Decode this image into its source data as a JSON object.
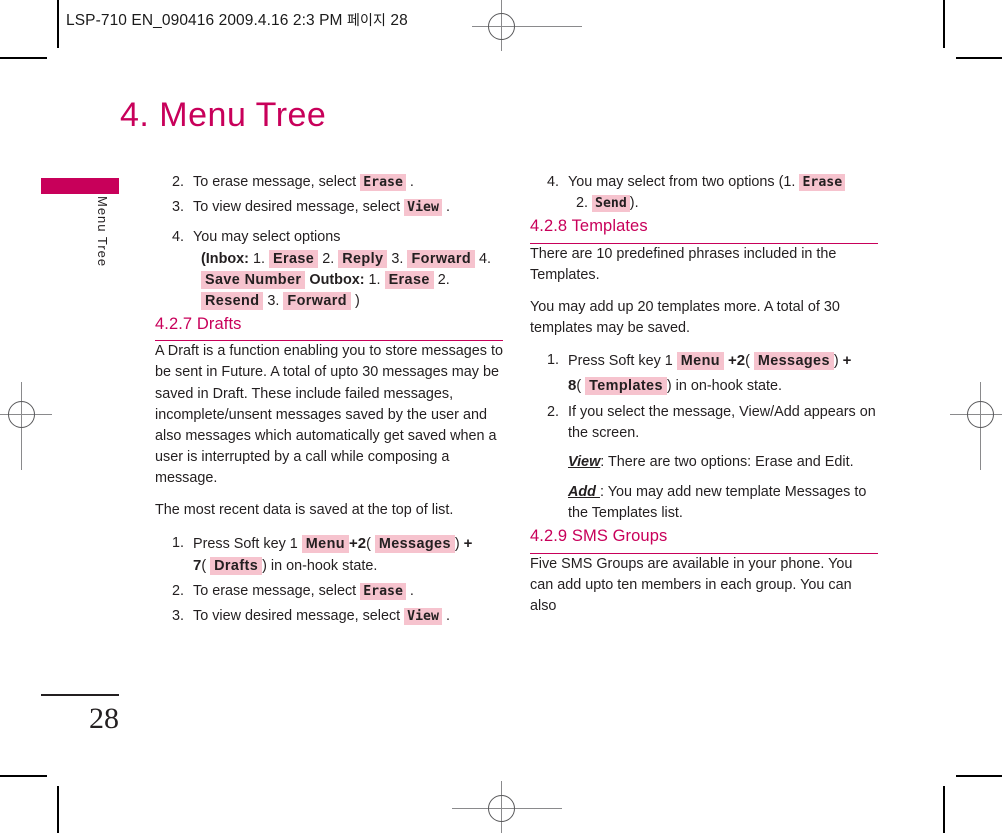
{
  "printer_slug": {
    "text": "LSP-710 EN_090416  2009.4.16 2:3 PM",
    "korean": "페이지",
    "page_ref": "28"
  },
  "chapter": {
    "title": "4. Menu Tree"
  },
  "sidetab": {
    "label": "Menu Tree",
    "color": "#c8005a"
  },
  "folio": {
    "page_number": "28"
  },
  "colors": {
    "accent": "#c8005a",
    "key_highlight": "#f6c3ce",
    "body_text": "#231f20"
  },
  "left_column": {
    "continued_steps": {
      "step2": {
        "num": "2.",
        "text_before": "To erase message, select",
        "key": "Erase",
        "text_after": "."
      },
      "step3": {
        "num": "3.",
        "text_before": "To view desired message, select",
        "key": "View",
        "text_after": "."
      },
      "step4": {
        "num": "4.",
        "text": "You may select options",
        "inbox_label": "(Inbox:",
        "inbox_1_num": "1.",
        "inbox_1_key": "Erase",
        "inbox_2_num": "2.",
        "inbox_2_key": "Reply",
        "inbox_3_num": "3.",
        "inbox_3_key": "Forward",
        "inbox_4_num": "4.",
        "inbox_4_key": "Save Number",
        "outbox_label": "Outbox:",
        "outbox_1_num": "1.",
        "outbox_1_key": "Erase",
        "outbox_2_num": "2.",
        "outbox_2_key": "Resend",
        "outbox_3_num": "3.",
        "outbox_3_key": "Forward",
        "close_paren": ")"
      }
    },
    "drafts": {
      "heading": "4.2.7 Drafts",
      "para1": "A Draft is a function enabling you to store messages to be sent in Future. A total of upto 30 messages may be saved in Draft. These include failed messages, incomplete/unsent messages saved by the user and also messages which automatically get saved when a user is interrupted by a call while composing a message.",
      "para2": "The most recent data is saved at the top of list.",
      "step1": {
        "num": "1.",
        "text_before": "Press Soft key 1",
        "key_menu": "Menu",
        "plus1": "+",
        "digit2": "2",
        "open1": "(",
        "key_messages": "Messages",
        "close1": ")",
        "plus2": "+",
        "digit7": "7",
        "open2": "(",
        "key_drafts": "Drafts",
        "close2": ")",
        "text_after": "in on-hook state."
      },
      "step2": {
        "num": "2.",
        "text_before": "To erase message, select",
        "key": "Erase",
        "text_after": "."
      },
      "step3": {
        "num": "3.",
        "text_before": "To view desired message, select",
        "key": "View",
        "text_after": "."
      }
    }
  },
  "right_column": {
    "continued_steps": {
      "step4": {
        "num": "4.",
        "text_before": "You may select from two options (1.",
        "key_erase": "Erase",
        "num2": "2.",
        "key_send": "Send",
        "text_after": ")."
      }
    },
    "templates": {
      "heading": "4.2.8 Templates",
      "para1": "There are 10 predefined phrases included in the Templates.",
      "para2": "You may add up 20 templates more. A total of 30 templates may be saved.",
      "step1": {
        "num": "1.",
        "text_before": "Press Soft key 1",
        "key_menu": "Menu",
        "plus1": "+",
        "digit2": "2",
        "open1": "(",
        "key_messages": "Messages",
        "close1": ")",
        "plus2": "+",
        "digit8": "8",
        "open2": "(",
        "key_templates": "Templates",
        "close2": ")",
        "text_after": "in on-hook state."
      },
      "step2": {
        "num": "2.",
        "text": "If you select the message, View/Add appears on the screen."
      },
      "view_note": {
        "label": "View",
        "text": ": There are two options: Erase and Edit."
      },
      "add_note": {
        "label": "Add ",
        "text": ": You may add new template Messages to the Templates list."
      }
    },
    "sms_groups": {
      "heading": "4.2.9 SMS Groups",
      "para1": "Five SMS Groups are available in your phone. You can add upto ten members in each group. You can also"
    }
  }
}
